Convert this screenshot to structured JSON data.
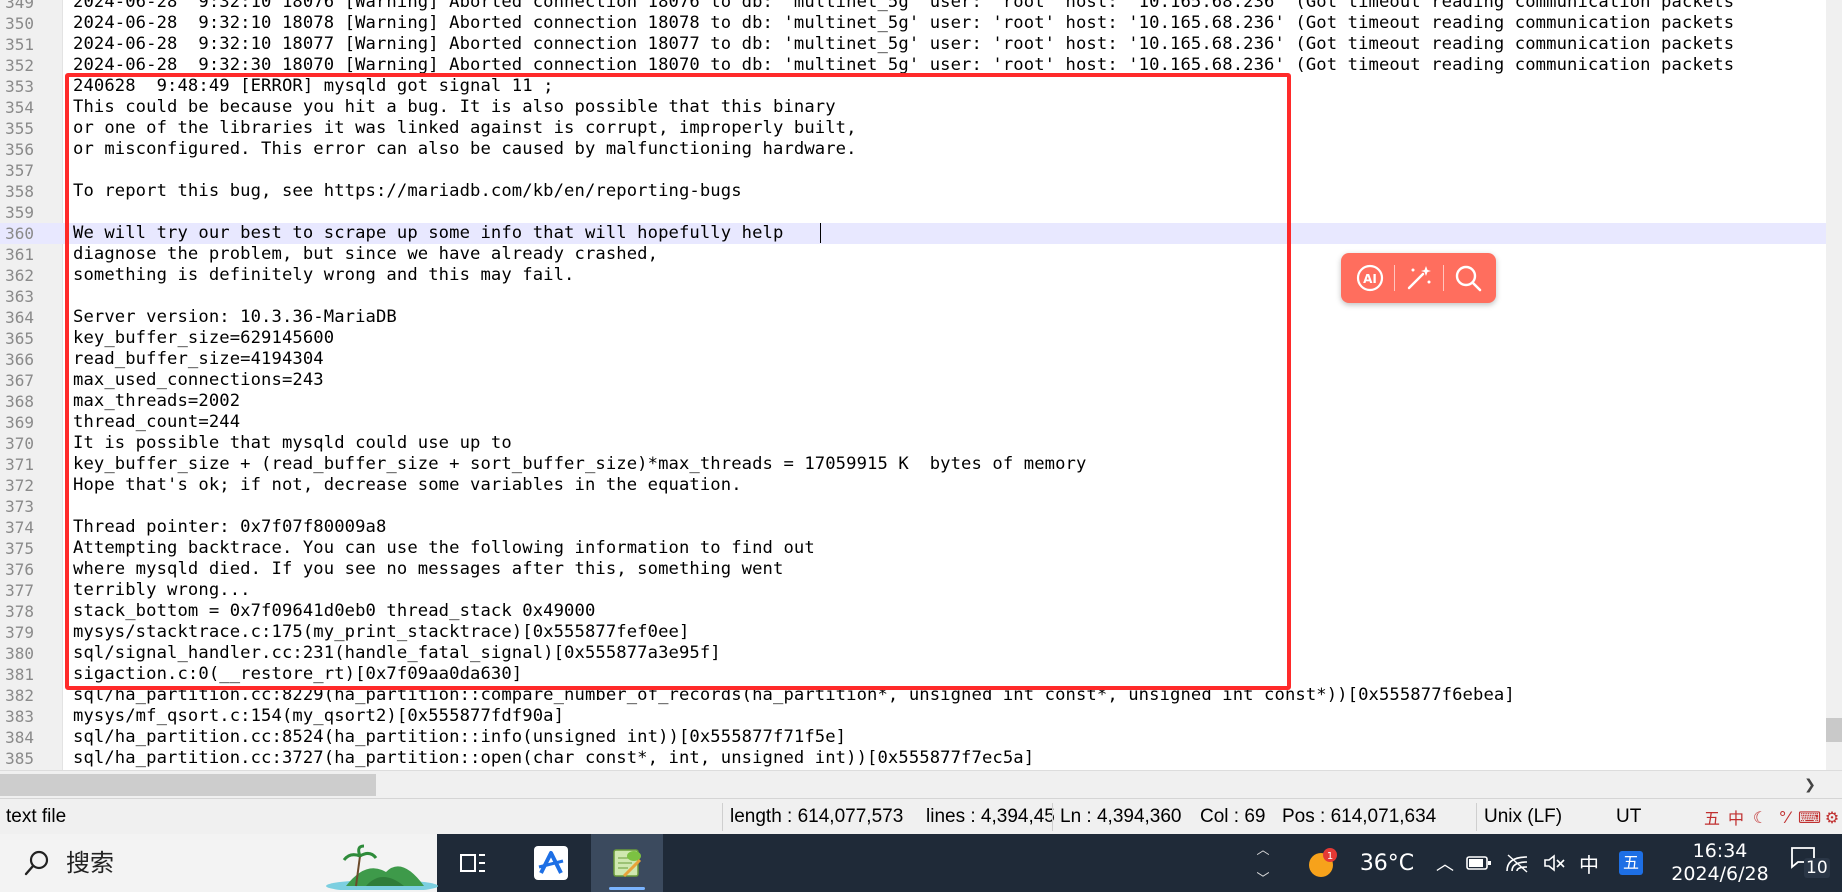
{
  "editor": {
    "first_line_number": 349,
    "current_line_index": 11,
    "lines": [
      "2024-06-28  9:32:10 18076 [Warning] Aborted connection 18076 to db: 'multinet_5g' user: 'root' host: '10.165.68.236' (Got timeout reading communication packets",
      "2024-06-28  9:32:10 18078 [Warning] Aborted connection 18078 to db: 'multinet_5g' user: 'root' host: '10.165.68.236' (Got timeout reading communication packets",
      "2024-06-28  9:32:10 18077 [Warning] Aborted connection 18077 to db: 'multinet_5g' user: 'root' host: '10.165.68.236' (Got timeout reading communication packets",
      "2024-06-28  9:32:30 18070 [Warning] Aborted connection 18070 to db: 'multinet_5g' user: 'root' host: '10.165.68.236' (Got timeout reading communication packets",
      "240628  9:48:49 [ERROR] mysqld got signal 11 ;",
      "This could be because you hit a bug. It is also possible that this binary",
      "or one of the libraries it was linked against is corrupt, improperly built,",
      "or misconfigured. This error can also be caused by malfunctioning hardware.",
      "",
      "To report this bug, see https://mariadb.com/kb/en/reporting-bugs",
      "",
      "We will try our best to scrape up some info that will hopefully help",
      "diagnose the problem, but since we have already crashed,",
      "something is definitely wrong and this may fail.",
      "",
      "Server version: 10.3.36-MariaDB",
      "key_buffer_size=629145600",
      "read_buffer_size=4194304",
      "max_used_connections=243",
      "max_threads=2002",
      "thread_count=244",
      "It is possible that mysqld could use up to",
      "key_buffer_size + (read_buffer_size + sort_buffer_size)*max_threads = 17059915 K  bytes of memory",
      "Hope that's ok; if not, decrease some variables in the equation.",
      "",
      "Thread pointer: 0x7f07f80009a8",
      "Attempting backtrace. You can use the following information to find out",
      "where mysqld died. If you see no messages after this, something went",
      "terribly wrong...",
      "stack_bottom = 0x7f09641d0eb0 thread_stack 0x49000",
      "mysys/stacktrace.c:175(my_print_stacktrace)[0x555877fef0ee]",
      "sql/signal_handler.cc:231(handle_fatal_signal)[0x555877a3e95f]",
      "sigaction.c:0(__restore_rt)[0x7f09aa0da630]",
      "sql/ha_partition.cc:8229(ha_partition::compare_number_of_records(ha_partition*, unsigned int const*, unsigned int const*))[0x555877f6ebea]",
      "mysys/mf_qsort.c:154(my_qsort2)[0x555877fdf90a]",
      "sql/ha_partition.cc:8524(ha_partition::info(unsigned int))[0x555877f71f5e]",
      "sql/ha_partition.cc:3727(ha_partition::open(char const*, int, unsigned int))[0x555877f7ec5a]"
    ]
  },
  "ai_toolbar": {
    "buttons": [
      {
        "name": "ai-icon",
        "label": "AI"
      },
      {
        "name": "magic-wand-icon",
        "label": ""
      },
      {
        "name": "search-icon",
        "label": ""
      }
    ],
    "color": "#ff6e5e"
  },
  "statusbar": {
    "file_type": "text file",
    "length": "length : 614,077,573",
    "lines": "lines : 4,394,45",
    "ln": "Ln : 4,394,360",
    "col": "Col : 69",
    "pos": "Pos : 614,071,634",
    "eol": "Unix (LF)",
    "encoding": "UT",
    "ime_icons": [
      "五",
      "中",
      "☾",
      "°⁄",
      "⌨",
      "⚙"
    ]
  },
  "taskbar": {
    "search_placeholder": "搜索",
    "weather_badge": "1",
    "temperature": "36°C",
    "tray_ime": "中",
    "tray_ime2": "五",
    "time": "16:34",
    "date": "2024/6/28",
    "notification_count": "10"
  },
  "colors": {
    "highlight_border": "#ff2a2a",
    "current_line": "#e8e8ff",
    "taskbar_bg": "#1f2a38"
  }
}
